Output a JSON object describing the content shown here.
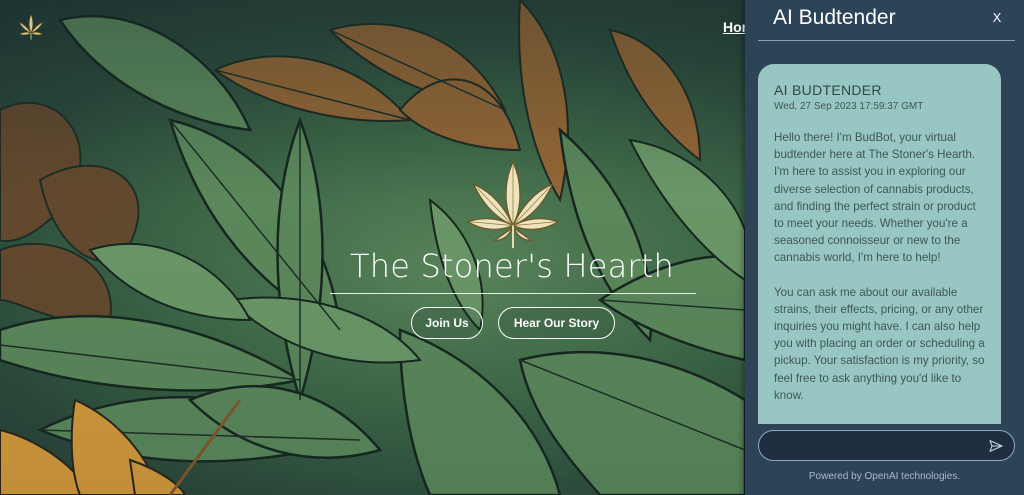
{
  "nav": {
    "home_label": "Home"
  },
  "hero": {
    "title": "The Stoner's Hearth",
    "join_label": "Join Us",
    "story_label": "Hear Our Story"
  },
  "chat": {
    "title": "AI Budtender",
    "close_label": "X",
    "message": {
      "sender": "AI BUDTENDER",
      "timestamp": "Wed, 27 Sep 2023 17:59:37 GMT",
      "paragraph1": "Hello there! I'm BudBot, your virtual budtender here at The Stoner's Hearth. I'm here to assist you in exploring our diverse selection of cannabis products, and finding the perfect strain or product to meet your needs. Whether you're a seasoned connoisseur or new to the cannabis world, I'm here to help!",
      "paragraph2": "You can ask me about our available strains, their effects, pricing, or any other inquiries you might have. I can also help you with placing an order or scheduling a pickup. Your satisfaction is my priority, so feel free to ask anything you'd like to know."
    },
    "input_value": "",
    "footer": "Powered by OpenAI technologies."
  },
  "icons": {
    "corner_logo": "cannabis-leaf-icon",
    "center_logo": "cannabis-leaf-icon",
    "send": "send-icon"
  },
  "colors": {
    "chat_panel": "#2d4358",
    "message_bubble": "#98c6c3",
    "leaf_gold": "#d9c48a"
  }
}
